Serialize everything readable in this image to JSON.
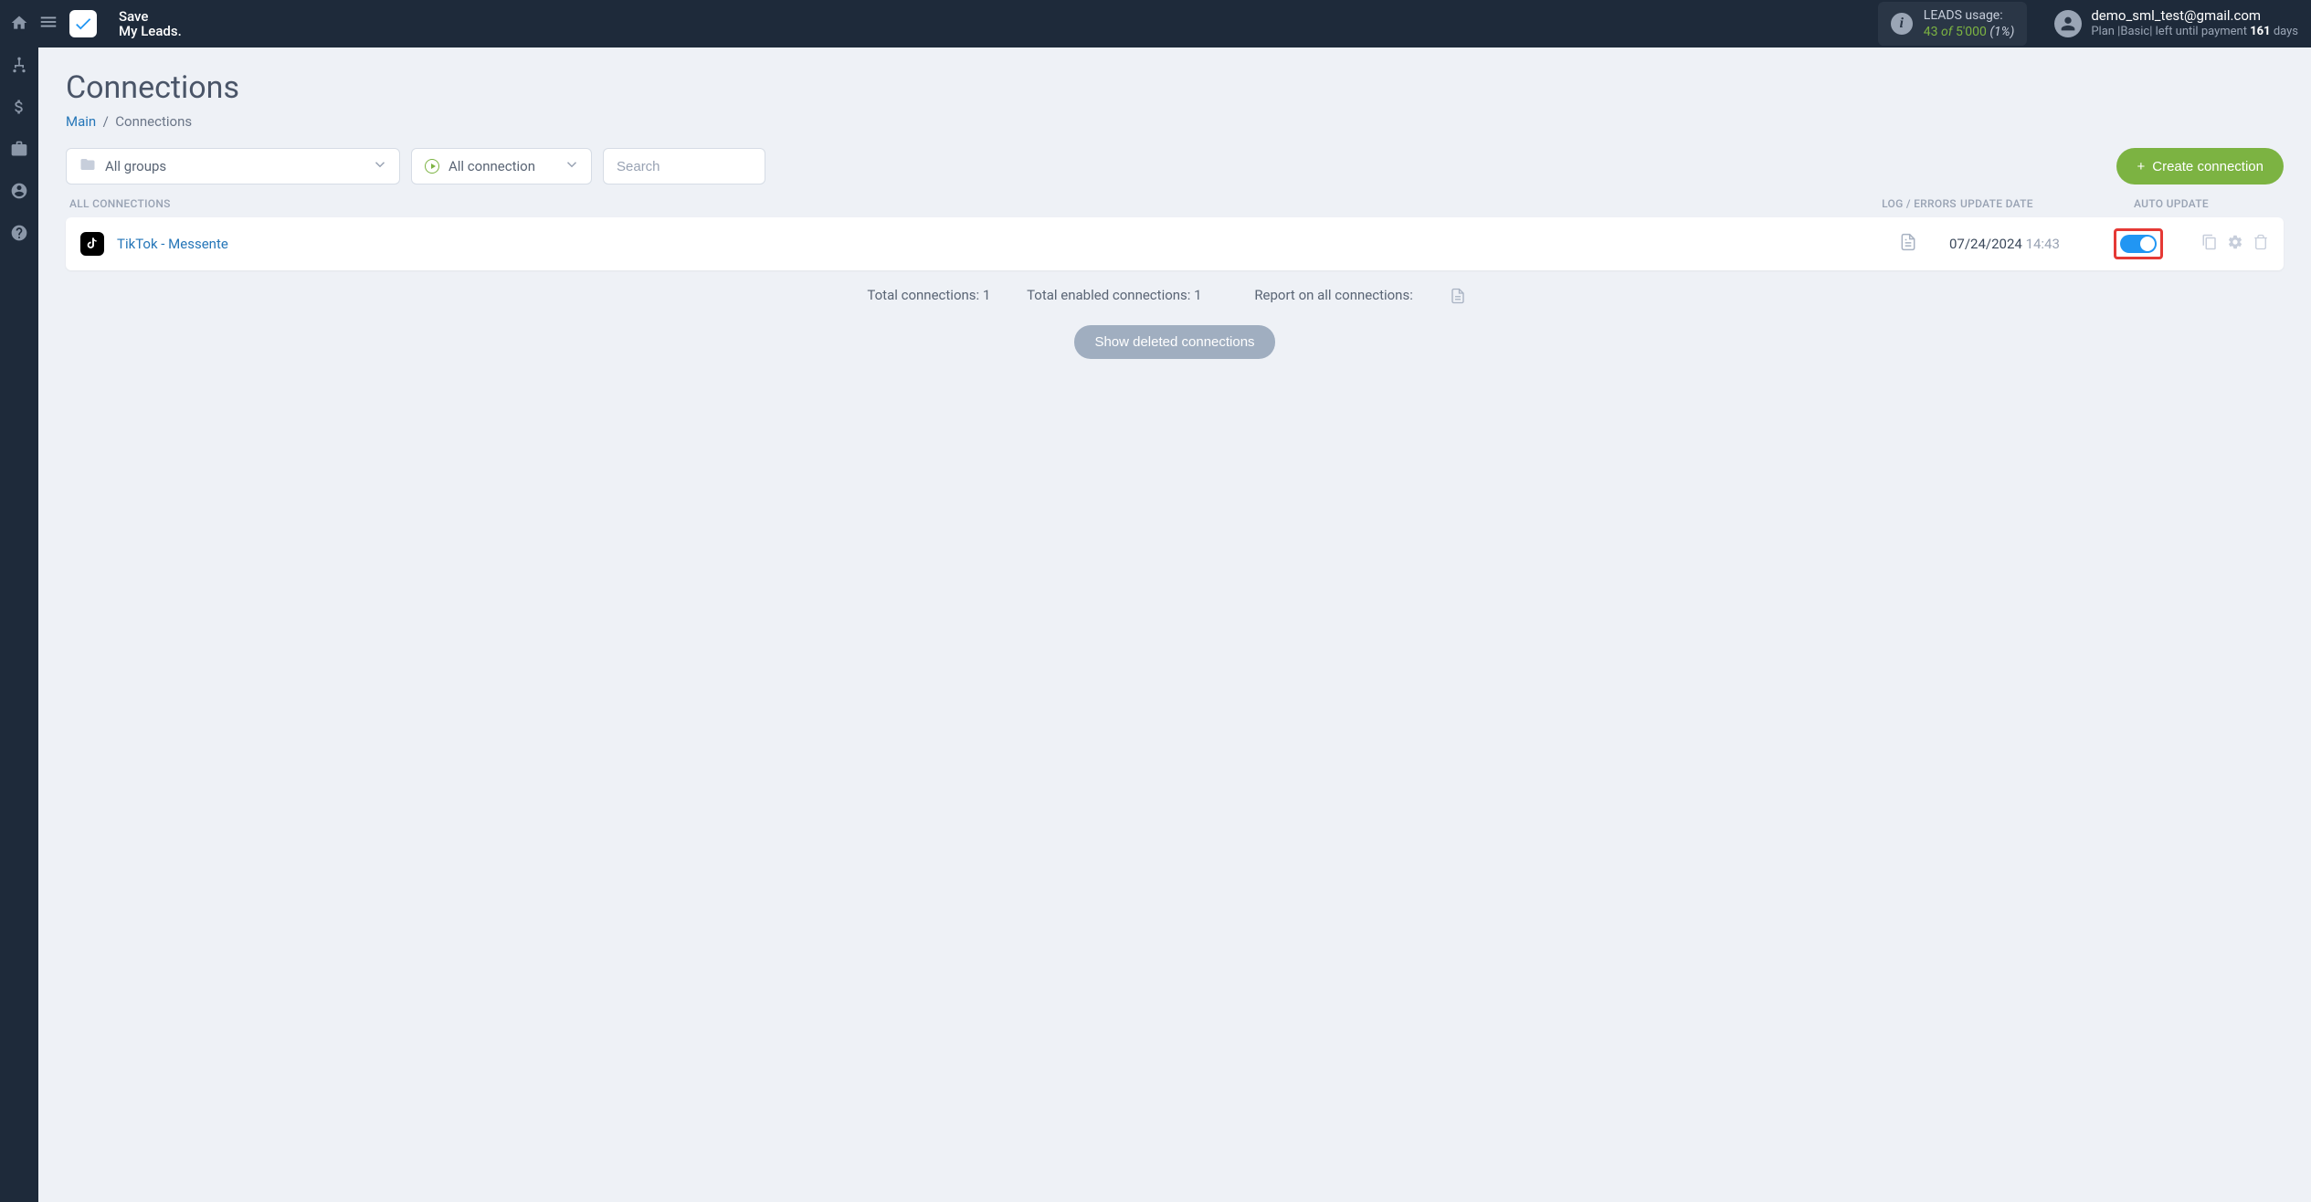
{
  "logo": {
    "line1": "Save",
    "line2": "My Leads."
  },
  "usage": {
    "label": "LEADS usage:",
    "used": "43",
    "of": "of",
    "total": "5'000",
    "pct": "(1%)"
  },
  "account": {
    "email": "demo_sml_test@gmail.com",
    "plan_prefix": "Plan |",
    "plan": "Basic",
    "left_text": "| left until payment",
    "days": "161",
    "days_label": "days"
  },
  "page": {
    "title": "Connections"
  },
  "breadcrumb": {
    "main": "Main",
    "sep": "/",
    "current": "Connections"
  },
  "filters": {
    "groups": "All groups",
    "status": "All connection",
    "search_placeholder": "Search"
  },
  "create_btn": "Create connection",
  "cols": {
    "name": "ALL CONNECTIONS",
    "log": "LOG / ERRORS",
    "date": "UPDATE DATE",
    "auto": "AUTO UPDATE"
  },
  "row": {
    "name": "TikTok - Messente",
    "date": "07/24/2024",
    "time": "14:43"
  },
  "summary": {
    "total": "Total connections: 1",
    "enabled": "Total enabled connections: 1",
    "report": "Report on all connections:"
  },
  "show_deleted": "Show deleted connections"
}
